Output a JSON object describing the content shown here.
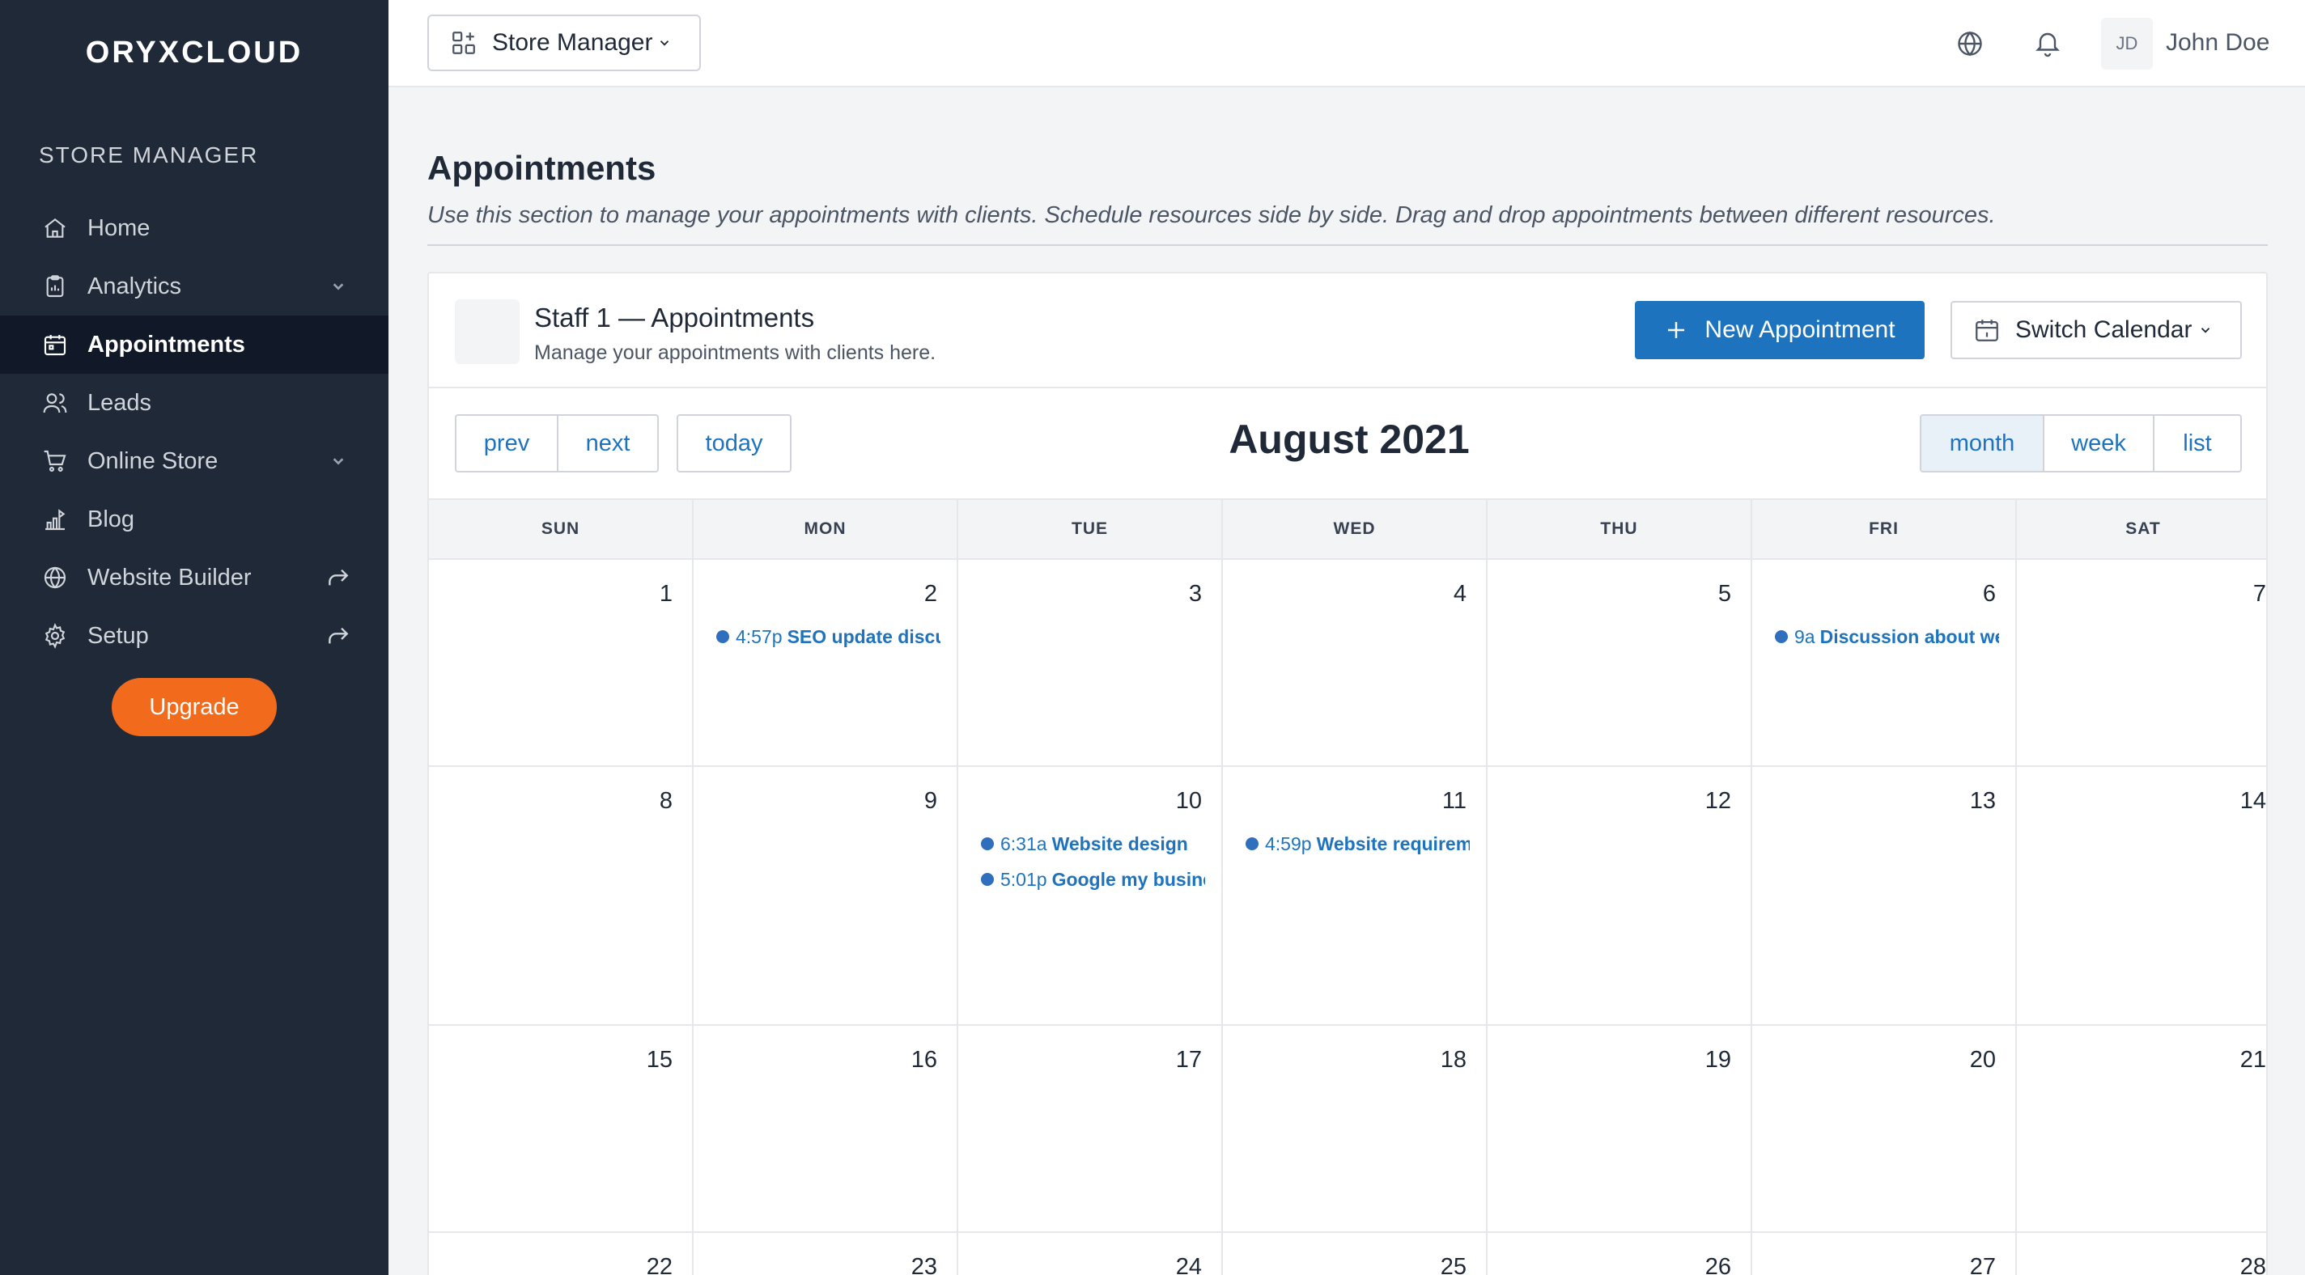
{
  "sidebar": {
    "logo": "ORYXCLOUD",
    "section": "STORE MANAGER",
    "items": [
      {
        "label": "Home",
        "icon": "home-icon"
      },
      {
        "label": "Analytics",
        "icon": "clipboard-icon",
        "trail": "chevron-down-icon"
      },
      {
        "label": "Appointments",
        "icon": "calendar-icon",
        "active": true
      },
      {
        "label": "Leads",
        "icon": "users-icon"
      },
      {
        "label": "Online Store",
        "icon": "cart-icon",
        "trail": "chevron-down-icon"
      },
      {
        "label": "Blog",
        "icon": "blog-icon"
      },
      {
        "label": "Website Builder",
        "icon": "globe-icon",
        "trail": "external-arrow-icon"
      },
      {
        "label": "Setup",
        "icon": "gear-icon",
        "trail": "external-arrow-icon"
      }
    ],
    "upgrade": "Upgrade"
  },
  "topbar": {
    "store_switch": "Store Manager",
    "avatar": "JD",
    "user": "John Doe"
  },
  "page": {
    "title": "Appointments",
    "description": "Use this section to manage your appointments with clients. Schedule resources side by side. Drag and drop appointments between different resources."
  },
  "card": {
    "title": "Staff 1 — Appointments",
    "subtitle": "Manage your appointments with clients here.",
    "new_button": "New Appointment",
    "switch_button": "Switch Calendar"
  },
  "toolbar": {
    "prev": "prev",
    "next": "next",
    "today": "today",
    "title": "August 2021",
    "views": [
      "month",
      "week",
      "list"
    ],
    "active_view": "month"
  },
  "calendar": {
    "days_of_week": [
      "SUN",
      "MON",
      "TUE",
      "WED",
      "THU",
      "FRI",
      "SAT"
    ],
    "weeks": [
      [
        {
          "day": "1",
          "events": []
        },
        {
          "day": "2",
          "events": [
            {
              "time": "4:57p",
              "title": "SEO update discussion"
            }
          ]
        },
        {
          "day": "3",
          "events": []
        },
        {
          "day": "4",
          "events": []
        },
        {
          "day": "5",
          "events": []
        },
        {
          "day": "6",
          "events": [
            {
              "time": "9a",
              "title": "Discussion about website"
            }
          ]
        },
        {
          "day": "7",
          "events": []
        }
      ],
      [
        {
          "day": "8",
          "events": []
        },
        {
          "day": "9",
          "events": []
        },
        {
          "day": "10",
          "events": [
            {
              "time": "6:31a",
              "title": "Website design"
            },
            {
              "time": "5:01p",
              "title": "Google my business"
            }
          ]
        },
        {
          "day": "11",
          "events": [
            {
              "time": "4:59p",
              "title": "Website requirements"
            }
          ]
        },
        {
          "day": "12",
          "events": []
        },
        {
          "day": "13",
          "events": []
        },
        {
          "day": "14",
          "events": []
        }
      ],
      [
        {
          "day": "15",
          "events": []
        },
        {
          "day": "16",
          "events": []
        },
        {
          "day": "17",
          "events": []
        },
        {
          "day": "18",
          "events": []
        },
        {
          "day": "19",
          "events": []
        },
        {
          "day": "20",
          "events": []
        },
        {
          "day": "21",
          "events": []
        }
      ],
      [
        {
          "day": "22",
          "events": []
        },
        {
          "day": "23",
          "events": []
        },
        {
          "day": "24",
          "events": []
        },
        {
          "day": "25",
          "events": []
        },
        {
          "day": "26",
          "events": []
        },
        {
          "day": "27",
          "events": []
        },
        {
          "day": "28",
          "events": []
        }
      ]
    ]
  },
  "colors": {
    "sidebar_bg": "#1f2937",
    "accent": "#1e73be",
    "upgrade": "#f26b1d",
    "event_dot": "#2f6fbd"
  }
}
